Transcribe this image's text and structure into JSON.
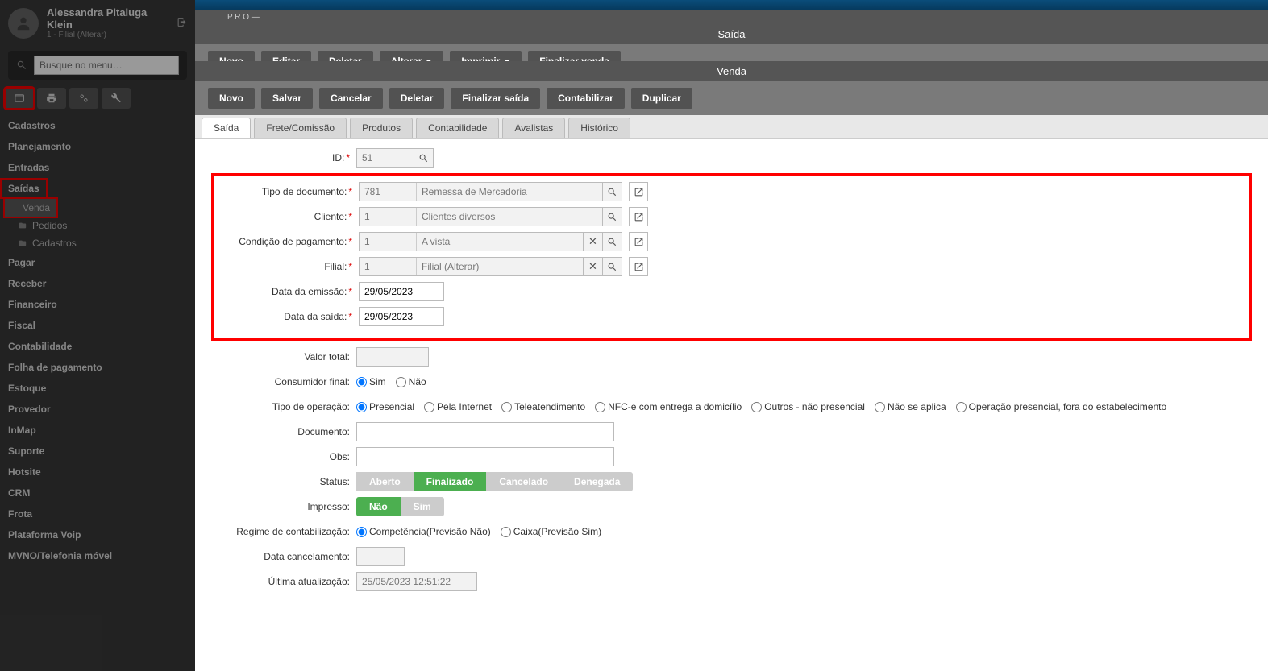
{
  "user": {
    "name": "Alessandra Pitaluga Klein",
    "branch": "1 - Filial (Alterar)"
  },
  "search": {
    "placeholder": "Busque no menu…"
  },
  "nav": {
    "cadastros": "Cadastros",
    "planejamento": "Planejamento",
    "entradas": "Entradas",
    "saidas": "Saídas",
    "venda": "Venda",
    "pedidos": "Pedidos",
    "cadastros_sub": "Cadastros",
    "pagar": "Pagar",
    "receber": "Receber",
    "financeiro": "Financeiro",
    "fiscal": "Fiscal",
    "contabilidade": "Contabilidade",
    "folha": "Folha de pagamento",
    "estoque": "Estoque",
    "provedor": "Provedor",
    "inmap": "InMap",
    "suporte": "Suporte",
    "hotsite": "Hotsite",
    "crm": "CRM",
    "frota": "Frota",
    "voip": "Plataforma Voip",
    "mvno": "MVNO/Telefonia móvel"
  },
  "app_bar_text": "P R O —",
  "back": {
    "title": "Saída",
    "buttons": {
      "novo": "Novo",
      "editar": "Editar",
      "deletar": "Deletar",
      "alterar": "Alterar",
      "imprimir": "Imprimir",
      "finalizar": "Finalizar venda"
    }
  },
  "front": {
    "title": "Venda",
    "buttons": {
      "novo": "Novo",
      "salvar": "Salvar",
      "cancelar": "Cancelar",
      "deletar": "Deletar",
      "finalizar_saida": "Finalizar saída",
      "contabilizar": "Contabilizar",
      "duplicar": "Duplicar"
    },
    "tabs": {
      "saida": "Saída",
      "frete": "Frete/Comissão",
      "produtos": "Produtos",
      "contabilidade": "Contabilidade",
      "avalistas": "Avalistas",
      "historico": "Histórico"
    }
  },
  "labels": {
    "id": "ID:",
    "tipo_doc": "Tipo de documento:",
    "cliente": "Cliente:",
    "cond_pag": "Condição de pagamento:",
    "filial": "Filial:",
    "data_emissao": "Data da emissão:",
    "data_saida": "Data da saída:",
    "valor_total": "Valor total:",
    "consumidor_final": "Consumidor final:",
    "tipo_operacao": "Tipo de operação:",
    "documento": "Documento:",
    "obs": "Obs:",
    "status": "Status:",
    "impresso": "Impresso:",
    "regime": "Regime de contabilização:",
    "data_cancelamento": "Data cancelamento:",
    "ultima_atualizacao": "Última atualização:"
  },
  "values": {
    "id": "51",
    "tipo_doc_code": "781",
    "tipo_doc_desc": "Remessa de Mercadoria",
    "cliente_code": "1",
    "cliente_desc": "Clientes diversos",
    "cond_pag_code": "1",
    "cond_pag_desc": "A vista",
    "filial_code": "1",
    "filial_desc": "Filial (Alterar)",
    "data_emissao": "29/05/2023",
    "data_saida": "29/05/2023",
    "valor_total": "",
    "documento": "",
    "obs": "",
    "data_cancelamento": "",
    "ultima_atualizacao": "25/05/2023 12:51:22"
  },
  "radios": {
    "sim": "Sim",
    "nao": "Não",
    "presencial": "Presencial",
    "internet": "Pela Internet",
    "tele": "Teleatendimento",
    "nfce": "NFC-e com entrega a domicílio",
    "outros_nao_pres": "Outros - não presencial",
    "nao_aplica": "Não se aplica",
    "op_fora": "Operação presencial, fora do estabelecimento",
    "competencia": "Competência(Previsão Não)",
    "caixa": "Caixa(Previsão Sim)"
  },
  "status": {
    "aberto": "Aberto",
    "finalizado": "Finalizado",
    "cancelado": "Cancelado",
    "denegada": "Denegada"
  },
  "impresso": {
    "nao": "Não",
    "sim": "Sim"
  }
}
